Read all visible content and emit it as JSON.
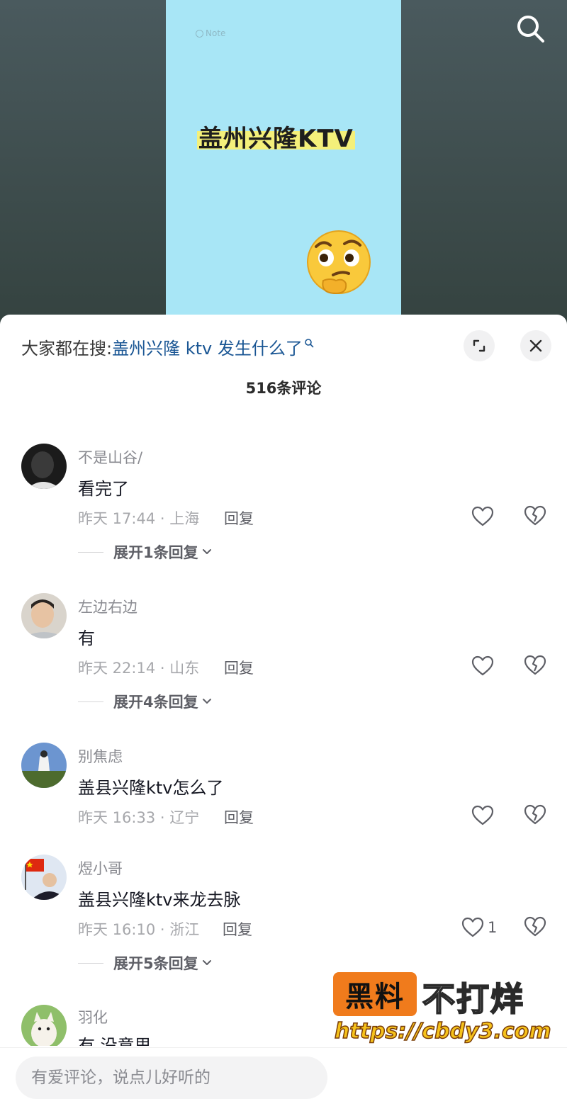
{
  "video": {
    "note_label": "Note",
    "title": "盖州兴隆KTV"
  },
  "hot_search": {
    "prefix": "大家都在搜:",
    "query": "盖州兴隆 ktv 发生什么了"
  },
  "comment_count": "516条评论",
  "comments": [
    {
      "user": "不是山谷/",
      "text": "看完了",
      "meta": "昨天 17:44 · 上海",
      "reply_label": "回复",
      "like_count": "",
      "expand_label": "展开1条回复"
    },
    {
      "user": "左边右边",
      "text": "有",
      "meta": "昨天 22:14 · 山东",
      "reply_label": "回复",
      "like_count": "",
      "expand_label": "展开4条回复"
    },
    {
      "user": "别焦虑",
      "text": "盖县兴隆ktv怎么了",
      "meta": "昨天 16:33 · 辽宁",
      "reply_label": "回复",
      "like_count": ""
    },
    {
      "user": "煜小哥",
      "text": "盖县兴隆ktv来龙去脉",
      "meta": "昨天 16:10 · 浙江",
      "reply_label": "回复",
      "like_count": "1",
      "expand_label": "展开5条回复"
    },
    {
      "user": "羽化",
      "text": "有  没意思"
    }
  ],
  "watermark": {
    "badge": "黑料",
    "tagline": "不打烊",
    "url": "https://cbdy3.com"
  },
  "input": {
    "placeholder": "有爱评论，说点儿好听的"
  },
  "icons": {
    "search": "search-icon",
    "expand": "expand-icon",
    "close": "close-icon",
    "like": "heart-icon",
    "dislike": "broken-heart-icon",
    "chevron": "chevron-down-icon"
  },
  "colors": {
    "link": "#1a5694",
    "card_bg": "#a8e6f6",
    "watermark_badge": "#f07b1c",
    "watermark_url": "#f6c21a"
  }
}
